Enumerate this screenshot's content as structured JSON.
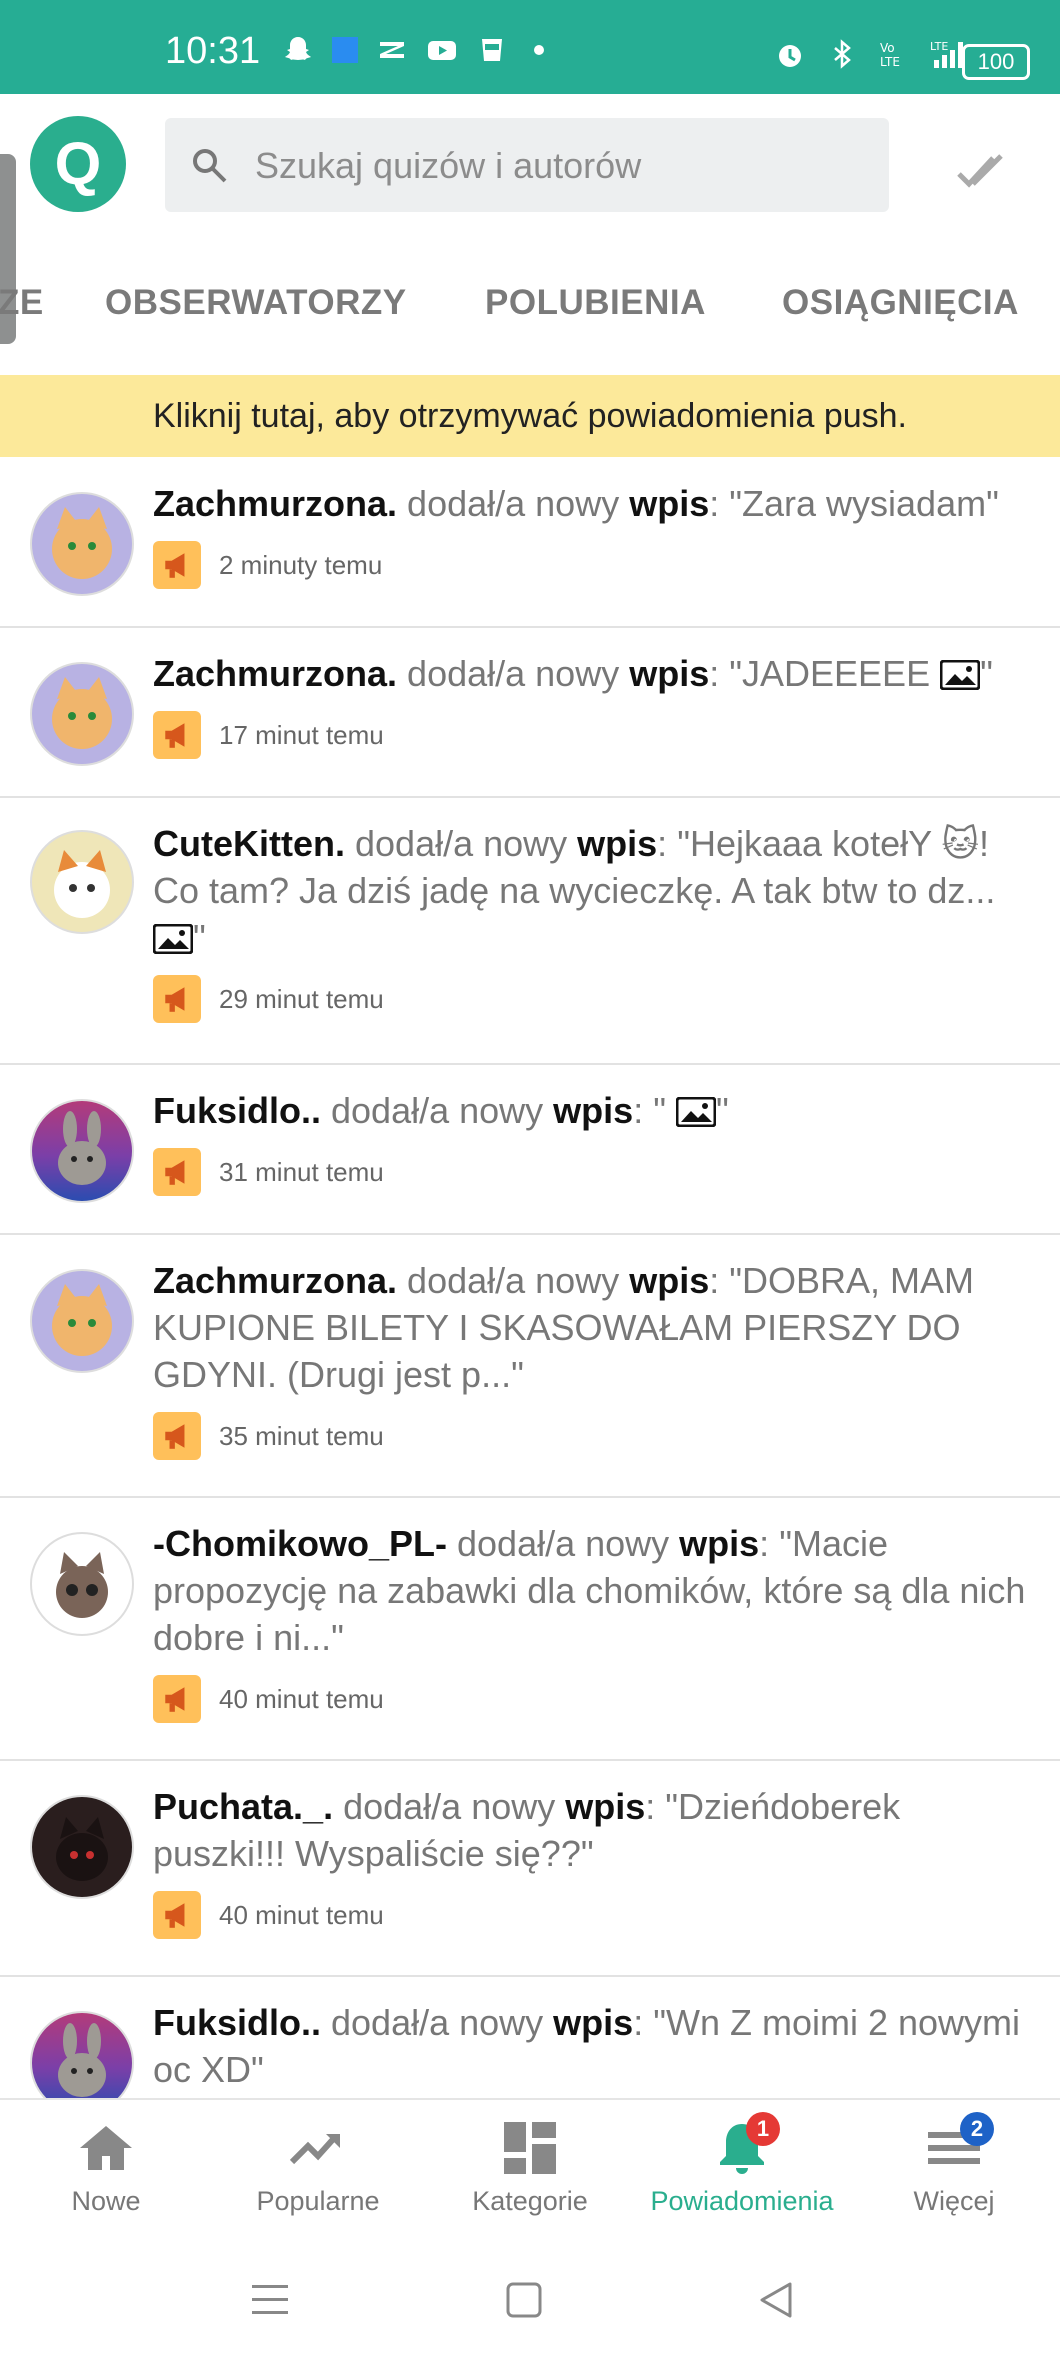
{
  "status": {
    "time": "10:31",
    "battery": "100"
  },
  "search": {
    "placeholder": "Szukaj quizów i autorów"
  },
  "tabs": [
    {
      "label": "ZE"
    },
    {
      "label": "OBSERWATORZY"
    },
    {
      "label": "POLUBIENIA"
    },
    {
      "label": "OSIĄGNIĘCIA"
    }
  ],
  "banner": "Kliknij tutaj, aby otrzymywać powiadomienia push.",
  "colors": {
    "accent": "#2aae8e",
    "statusbar": "#26ad94",
    "banner": "#fce99a",
    "megaphone_bg": "#ffc05a"
  },
  "feed": [
    {
      "name": "Zachmurzona.",
      "action": " dodał/a nowy ",
      "keyword": "wpis",
      "sep": ": ",
      "text": "\"Zara wysiadam\"",
      "time": "2 minuty temu"
    },
    {
      "name": "Zachmurzona.",
      "action": " dodał/a nowy ",
      "keyword": "wpis",
      "sep": ": ",
      "text": "\"JADEEEEE ",
      "text_after": "\"",
      "time": "17 minut temu"
    },
    {
      "name": "CuteKitten.",
      "action": " dodał/a nowy ",
      "keyword": "wpis",
      "sep": ": ",
      "text": "\"Hejkaaa kotełY 🐱! Co tam? Ja dziś jadę na wycieczkę. A tak btw to dz... ",
      "text_after": "\"",
      "time": "29 minut temu"
    },
    {
      "name": "Fuksidlo..",
      "action": " dodał/a nowy ",
      "keyword": "wpis",
      "sep": ": ",
      "text": "\" ",
      "text_after": "\"",
      "time": "31 minut temu"
    },
    {
      "name": "Zachmurzona.",
      "action": " dodał/a nowy ",
      "keyword": "wpis",
      "sep": ": ",
      "text": "\"DOBRA, MAM KUPIONE BILETY I SKASOWAŁAM PIERSZY DO GDYNI. (Drugi jest p...\"",
      "time": "35 minut temu"
    },
    {
      "name": "-Chomikowo_PL-",
      "action": " dodał/a nowy ",
      "keyword": "wpis",
      "sep": ": ",
      "text": "\"Macie propozycję na zabawki dla chomików, które są dla nich dobre i ni...\"",
      "time": "40 minut temu"
    },
    {
      "name": "Puchata._.",
      "action": " dodał/a nowy ",
      "keyword": "wpis",
      "sep": ": ",
      "text": "\"Dzieńdoberek puszki!!! Wyspaliście się??\"",
      "time": "40 minut temu"
    },
    {
      "name": "Fuksidlo..",
      "action": " dodał/a nowy ",
      "keyword": "wpis",
      "sep": ": ",
      "text": "\"Wn Z moimi 2 nowymi oc XD\"",
      "time": ""
    }
  ],
  "nav": [
    {
      "label": "Nowe",
      "icon": "home-icon"
    },
    {
      "label": "Popularne",
      "icon": "trending-icon"
    },
    {
      "label": "Kategorie",
      "icon": "grid-icon"
    },
    {
      "label": "Powiadomienia",
      "icon": "bell-icon",
      "badge": "1"
    },
    {
      "label": "Więcej",
      "icon": "menu-icon",
      "badge": "2"
    }
  ]
}
